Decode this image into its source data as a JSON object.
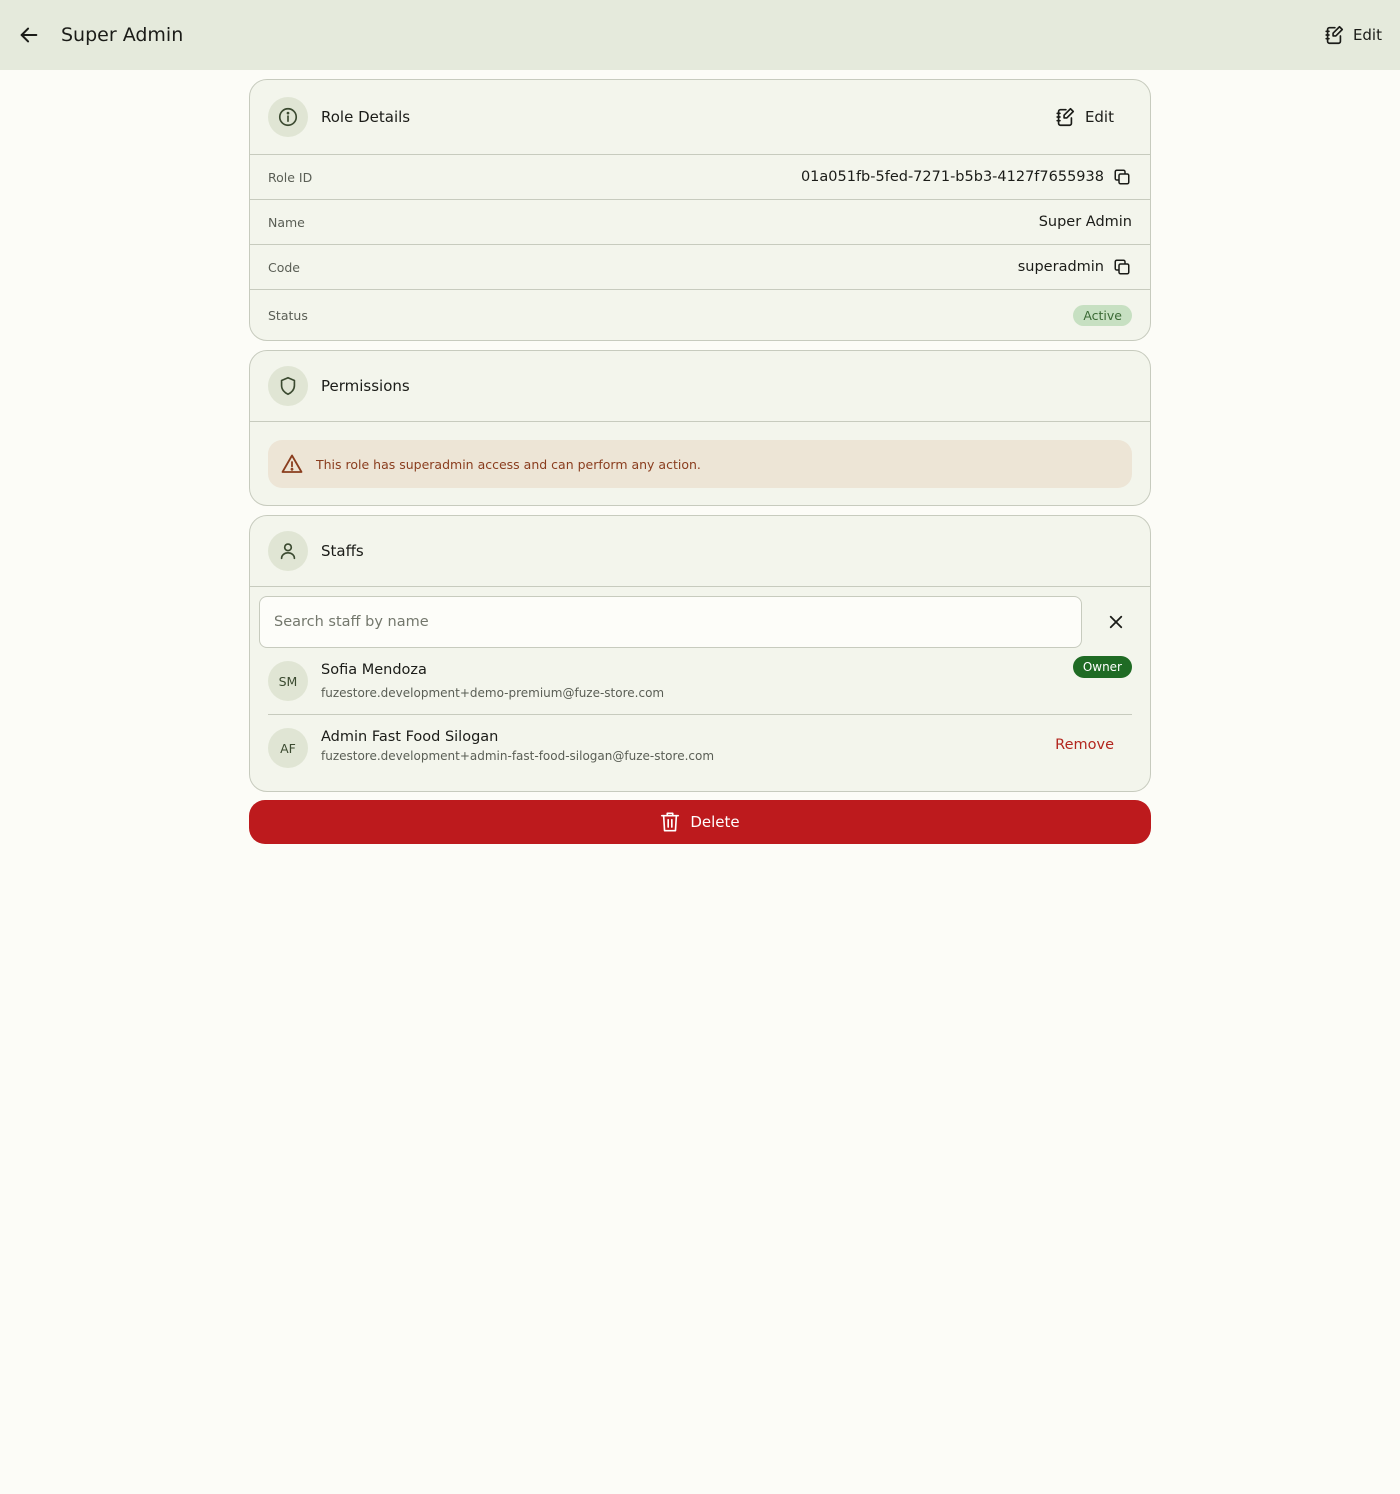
{
  "appbar": {
    "title": "Super Admin",
    "edit_label": "Edit"
  },
  "role_details": {
    "title": "Role Details",
    "edit_label": "Edit",
    "rows": {
      "role_id": {
        "label": "Role ID",
        "value": "01a051fb-5fed-7271-b5b3-4127f7655938"
      },
      "name": {
        "label": "Name",
        "value": "Super Admin"
      },
      "code": {
        "label": "Code",
        "value": "superadmin"
      },
      "status": {
        "label": "Status",
        "value": "Active"
      }
    }
  },
  "permissions": {
    "title": "Permissions",
    "warning": "This role has superadmin access and can perform any action."
  },
  "staffs": {
    "title": "Staffs",
    "search_placeholder": "Search staff by name",
    "items": [
      {
        "initials": "SM",
        "name": "Sofia Mendoza",
        "email": "fuzestore.development+demo-premium@fuze-store.com",
        "badge": "Owner"
      },
      {
        "initials": "AF",
        "name": "Admin Fast Food Silogan",
        "email": "fuzestore.development+admin-fast-food-silogan@fuze-store.com",
        "action": "Remove"
      }
    ]
  },
  "delete_label": "Delete",
  "colors": {
    "appbar_bg": "#e5eadc",
    "card_bg": "#f3f5ec",
    "delete": "#bd1a1d",
    "owner_badge": "#1f6b24",
    "active_badge": "#c7e0c2",
    "remove_text": "#b3261e"
  }
}
